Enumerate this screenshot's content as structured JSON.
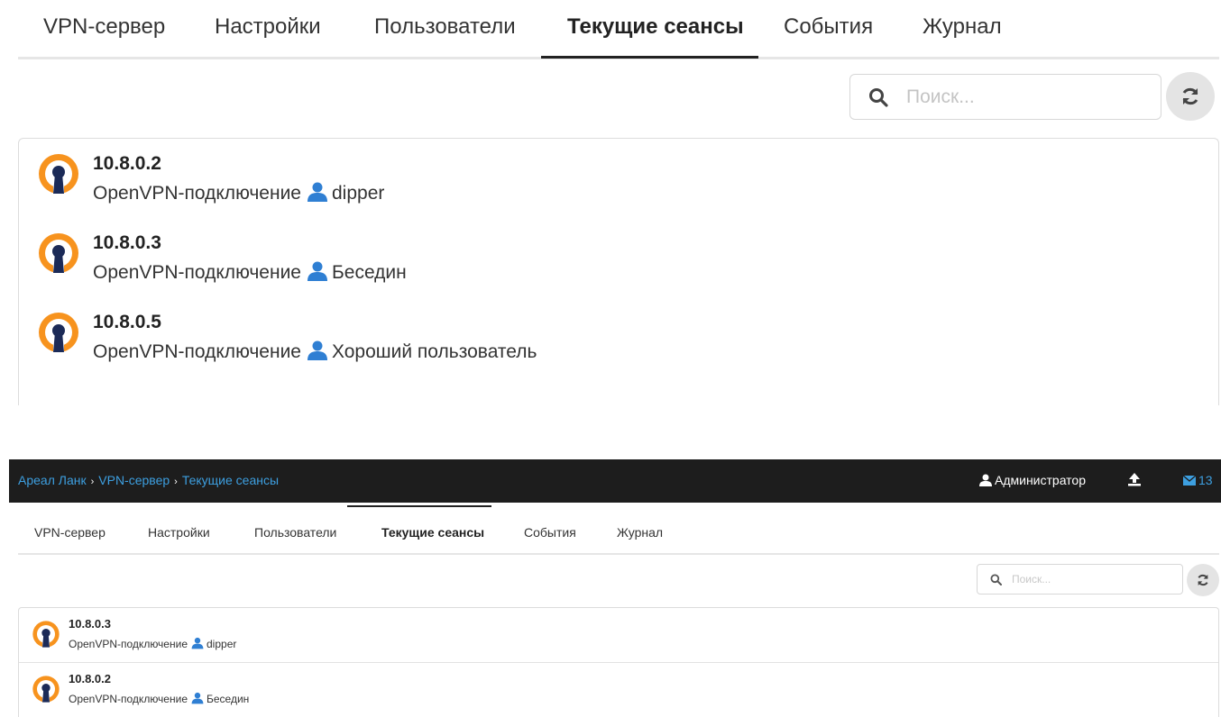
{
  "tabs": [
    "VPN-сервер",
    "Настройки",
    "Пользователи",
    "Текущие сеансы",
    "События",
    "Журнал"
  ],
  "active_tab": "Текущие сеансы",
  "search": {
    "placeholder": "Поиск..."
  },
  "zoomed_sessions": [
    {
      "ip": "10.8.0.2",
      "type": "OpenVPN-подключение",
      "user": "dipper"
    },
    {
      "ip": "10.8.0.3",
      "type": "OpenVPN-подключение",
      "user": "Беседин"
    },
    {
      "ip": "10.8.0.5",
      "type": "OpenVPN-подключение",
      "user": "Хороший пользователь"
    }
  ],
  "header": {
    "breadcrumbs": [
      "Ареал Ланк",
      "VPN-сервер",
      "Текущие сеансы"
    ],
    "breadcrumb_separator": "›",
    "user_name": "Администратор",
    "mail_count": "13"
  },
  "sessions": [
    {
      "ip": "10.8.0.3",
      "type": "OpenVPN-подключение",
      "user": "dipper"
    },
    {
      "ip": "10.8.0.2",
      "type": "OpenVPN-подключение",
      "user": "Беседин"
    }
  ],
  "colors": {
    "accent_blue": "#3d9fe0",
    "openvpn_orange": "#f7931e",
    "openvpn_navy": "#1b2a57",
    "topbar_bg": "#1d1d1d",
    "user_icon": "#2f7fd3"
  },
  "icons": {
    "search": "search-icon",
    "refresh": "refresh-icon",
    "openvpn": "openvpn-icon",
    "user": "user-icon",
    "upload": "upload-icon",
    "mail": "mail-icon"
  }
}
